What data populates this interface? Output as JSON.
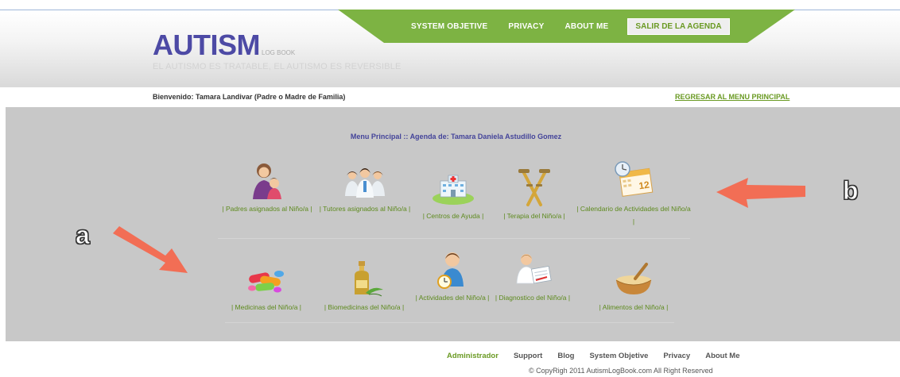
{
  "nav": {
    "items": [
      "SYSTEM OBJETIVE",
      "PRIVACY",
      "ABOUT ME"
    ],
    "exit_label": "SALIR DE LA AGENDA"
  },
  "logo": {
    "main": "AUTISM",
    "sub": "LOG BOOK"
  },
  "tagline": "EL AUTISMO ES TRATABLE, EL AUTISMO ES REVERSIBLE",
  "welcome": "Bienvenido: Tamara Landivar (Padre o Madre de Familia)",
  "back_link": "REGRESAR AL MENU PRINCIPAL",
  "menu_title": "Menu Principal :: Agenda de: Tamara Daniela Astudillo Gomez",
  "tiles_row1": [
    {
      "label": "| Padres asignados al Niño/a |",
      "icon": "parents-icon"
    },
    {
      "label": "| Tutores asignados al Niño/a |",
      "icon": "tutors-icon"
    },
    {
      "label": "| Centros de Ayuda |",
      "icon": "help-center-icon"
    },
    {
      "label": "| Terapia del Niño/a |",
      "icon": "crutches-icon"
    },
    {
      "label": "| Calendario de Actividades del Niño/a |",
      "icon": "calendar-icon"
    }
  ],
  "tiles_row2": [
    {
      "label": "| Medicinas del Niño/a |",
      "icon": "pills-icon"
    },
    {
      "label": "| Biomedicinas del Niño/a |",
      "icon": "herbal-bottle-icon"
    },
    {
      "label": "| Actividades del Niño/a |",
      "icon": "child-clock-icon"
    },
    {
      "label": "| Diagnostico del Niño/a |",
      "icon": "doctor-diagnosis-icon"
    },
    {
      "label": "| Alimentos del Niño/a |",
      "icon": "food-bowl-icon"
    }
  ],
  "markers": {
    "a": "a",
    "b": "b"
  },
  "footer": {
    "links": [
      "Administrador",
      "Support",
      "Blog",
      "System Objetive",
      "Privacy",
      "About Me"
    ],
    "copyright": "© CopyRigh 2011 AutismLogBook.com All Right Reserved"
  },
  "colors": {
    "brand": "#4d4aa5",
    "accent_green": "#7cb342",
    "link_green": "#6a9a23",
    "panel_grey": "#c8c8c8",
    "arrow": "#f07050"
  }
}
